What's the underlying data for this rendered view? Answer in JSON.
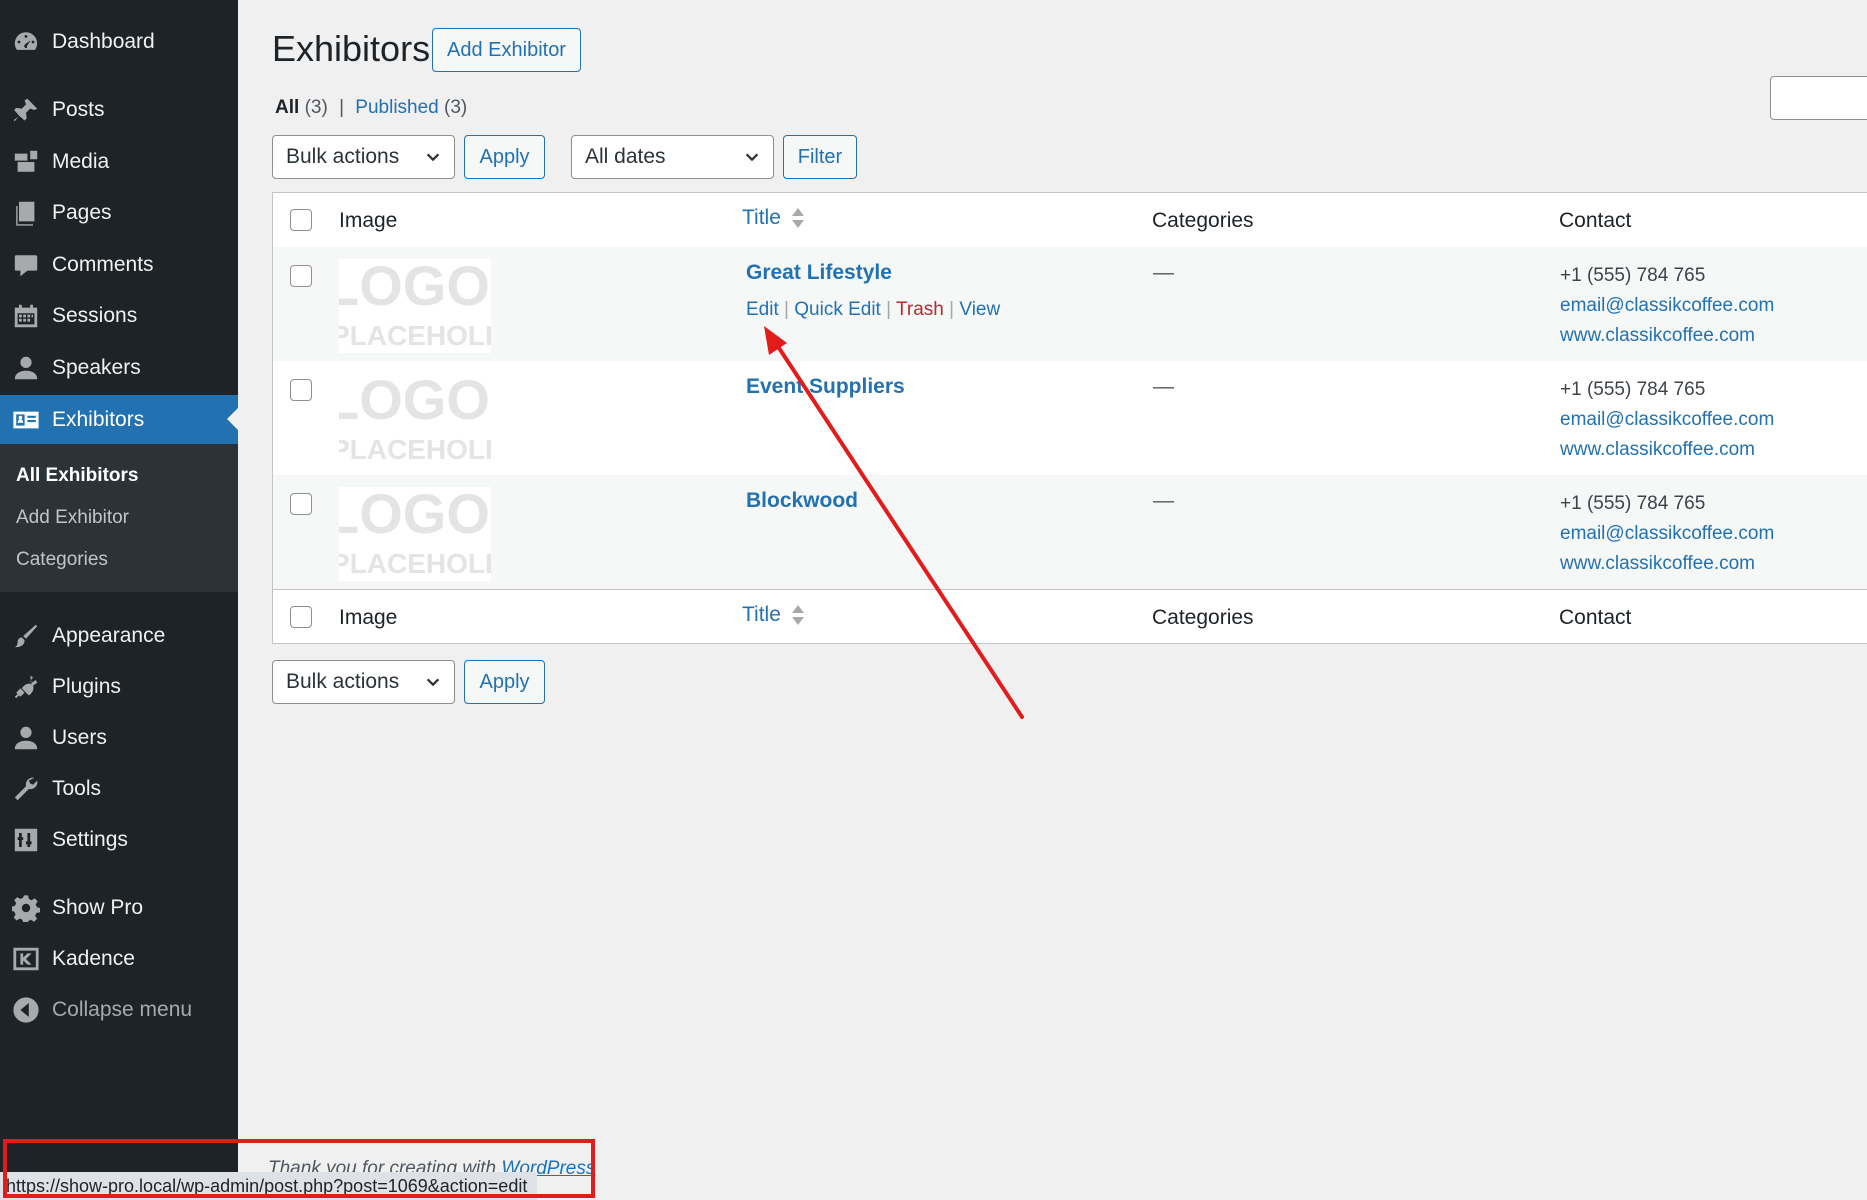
{
  "sidebar": {
    "menu": [
      {
        "label": "Dashboard",
        "icon": "dashboard-icon"
      },
      {
        "label": "Posts",
        "icon": "pin-icon"
      },
      {
        "label": "Media",
        "icon": "media-icon"
      },
      {
        "label": "Pages",
        "icon": "pages-icon"
      },
      {
        "label": "Comments",
        "icon": "comment-icon"
      },
      {
        "label": "Sessions",
        "icon": "calendar-icon"
      },
      {
        "label": "Speakers",
        "icon": "user-icon"
      },
      {
        "label": "Exhibitors",
        "icon": "id-card-icon",
        "active": true
      },
      {
        "label": "Appearance",
        "icon": "brush-icon"
      },
      {
        "label": "Plugins",
        "icon": "plugin-icon"
      },
      {
        "label": "Users",
        "icon": "users-icon"
      },
      {
        "label": "Tools",
        "icon": "wrench-icon"
      },
      {
        "label": "Settings",
        "icon": "settings-icon"
      },
      {
        "label": "Show Pro",
        "icon": "gear-icon"
      },
      {
        "label": "Kadence",
        "icon": "kadence-icon"
      },
      {
        "label": "Collapse menu",
        "icon": "collapse-icon"
      }
    ],
    "submenu": [
      {
        "label": "All Exhibitors",
        "current": true
      },
      {
        "label": "Add Exhibitor"
      },
      {
        "label": "Categories"
      }
    ]
  },
  "header": {
    "title": "Exhibitors",
    "add_button": "Add Exhibitor"
  },
  "views": {
    "all_label": "All",
    "all_count": "(3)",
    "separator": "|",
    "published_label": "Published",
    "published_count": "(3)"
  },
  "toolbar_top": {
    "bulk_actions": "Bulk actions",
    "apply": "Apply",
    "dates": "All dates",
    "filter": "Filter"
  },
  "toolbar_bottom": {
    "bulk_actions": "Bulk actions",
    "apply": "Apply"
  },
  "table": {
    "columns": {
      "image": "Image",
      "title": "Title",
      "categories": "Categories",
      "contact": "Contact"
    },
    "placeholder": {
      "line1": "LOGO",
      "line2": "PLACEHOLDER"
    },
    "rows": [
      {
        "title": "Great Lifestyle",
        "categories": "—",
        "phone": "+1 (555) 784 765",
        "email": "email@classikcoffee.com",
        "website": "www.classikcoffee.com"
      },
      {
        "title": "Event Suppliers",
        "categories": "—",
        "phone": "+1 (555) 784 765",
        "email": "email@classikcoffee.com",
        "website": "www.classikcoffee.com"
      },
      {
        "title": "Blockwood",
        "categories": "—",
        "phone": "+1 (555) 784 765",
        "email": "email@classikcoffee.com",
        "website": "www.classikcoffee.com"
      }
    ],
    "row_actions": {
      "edit": "Edit",
      "quick_edit": "Quick Edit",
      "trash": "Trash",
      "view": "View",
      "sep": "|"
    }
  },
  "footer": {
    "thanks_prefix": "Thank you for creating with",
    "thanks_link": "WordPress"
  },
  "status_bar": {
    "url": "https://show-pro.local/wp-admin/post.php?post=1069&action=edit"
  },
  "colors": {
    "sidebar_bg": "#1d2327",
    "accent": "#2271b1",
    "annotation_red": "#e21b1b"
  }
}
